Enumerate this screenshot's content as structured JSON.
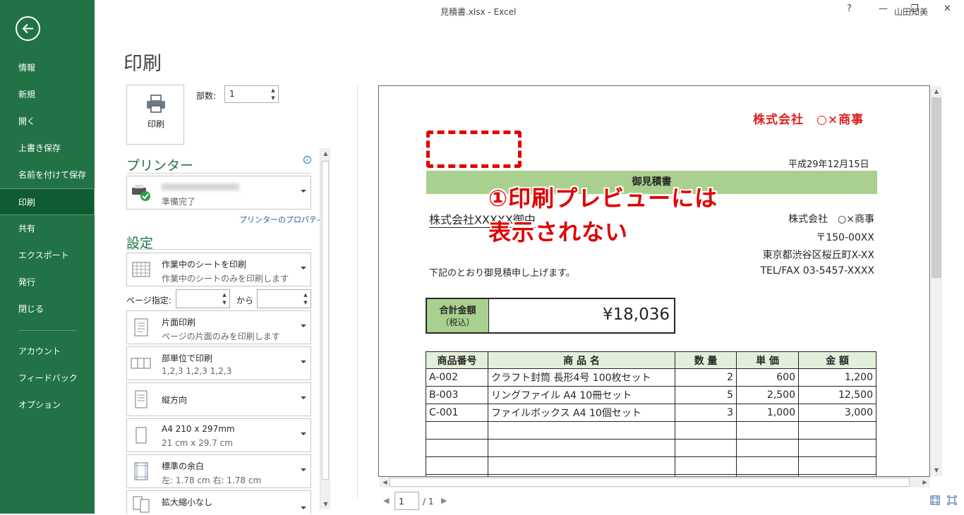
{
  "window": {
    "title": "見積書.xlsx  -  Excel",
    "user": "山田知美",
    "help": "?",
    "minimize": "—",
    "restore": "❐",
    "close": "✕"
  },
  "sidebar": {
    "items": [
      {
        "label": "情報"
      },
      {
        "label": "新規"
      },
      {
        "label": "開く"
      },
      {
        "label": "上書き保存"
      },
      {
        "label": "名前を付けて保存"
      },
      {
        "label": "印刷"
      },
      {
        "label": "共有"
      },
      {
        "label": "エクスポート"
      },
      {
        "label": "発行"
      },
      {
        "label": "閉じる"
      },
      {
        "label": "アカウント"
      },
      {
        "label": "フィードバック"
      },
      {
        "label": "オプション"
      }
    ],
    "active": "印刷"
  },
  "print": {
    "heading": "印刷",
    "print_button": "印刷",
    "copies_label": "部数:",
    "copies_value": "1"
  },
  "printer": {
    "heading": "プリンター",
    "status": "準備完了",
    "properties_link": "プリンターのプロパティ"
  },
  "settings": {
    "heading": "設定",
    "sheets": {
      "main": "作業中のシートを印刷",
      "sub": "作業中のシートのみを印刷します"
    },
    "pages_label": "ページ指定:",
    "pages_to": "から",
    "sides": {
      "main": "片面印刷",
      "sub": "ページの片面のみを印刷します"
    },
    "collate": {
      "main": "部単位で印刷",
      "sub": "1,2,3    1,2,3    1,2,3"
    },
    "orientation": {
      "main": "縦方向"
    },
    "paper": {
      "main": "A4 210 x 297mm",
      "sub": "21 cm x 29.7 cm"
    },
    "margins": {
      "main": "標準の余白",
      "sub": "左:  1.78 cm     右:  1.78 cm"
    },
    "scaling": {
      "main": "拡大縮小なし"
    }
  },
  "preview": {
    "company_header": "株式会社　○×商事",
    "date": "平成29年12月15日",
    "doc_title": "御見積書",
    "client": "株式会社XXXXX御中",
    "seller_name": "株式会社　○×商事",
    "seller_zip": "〒150-00XX",
    "seller_addr": "東京都渋谷区桜丘町X-XX",
    "seller_tel": "TEL/FAX 03-5457-XXXX",
    "note": "下記のとおり御見積申し上げます。",
    "callout_line1": "①印刷プレビューには",
    "callout_line2": "表示されない",
    "total_label": "合計金額",
    "total_sub": "（税込）",
    "total_amount": "¥18,036",
    "table": {
      "headers": [
        "商品番号",
        "商 品 名",
        "数 量",
        "単 価",
        "金 額"
      ],
      "rows": [
        [
          "A-002",
          "クラフト封筒 長形4号 100枚セット",
          "2",
          "600",
          "1,200"
        ],
        [
          "B-003",
          "リングファイル A4 10冊セット",
          "5",
          "2,500",
          "12,500"
        ],
        [
          "C-001",
          "ファイルボックス A4 10個セット",
          "3",
          "1,000",
          "3,000"
        ]
      ]
    },
    "page_current": "1",
    "page_total": "/ 1"
  },
  "colors": {
    "sidebar": "#217346",
    "accent_green": "#a9d08e",
    "callout_red": "#e00000"
  }
}
